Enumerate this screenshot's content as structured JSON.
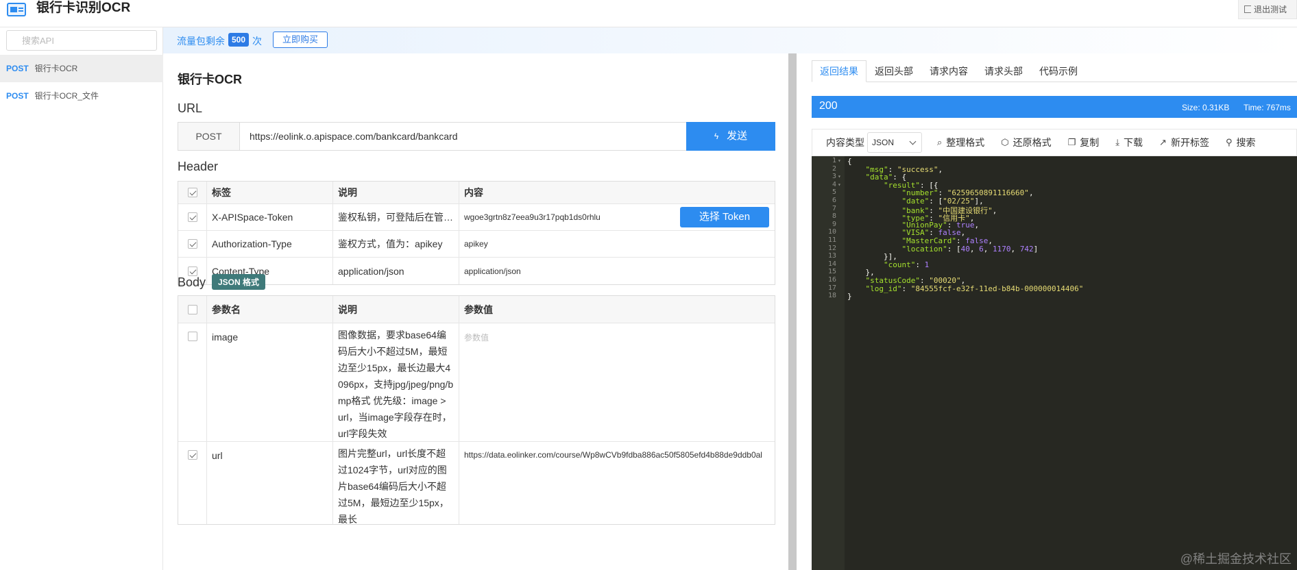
{
  "app": {
    "title": "银行卡识别OCR",
    "logout_label": "退出测试"
  },
  "sidebar": {
    "search_placeholder": "搜索API",
    "items": [
      {
        "method": "POST",
        "name": "银行卡OCR"
      },
      {
        "method": "POST",
        "name": "银行卡OCR_文件"
      }
    ]
  },
  "traffic": {
    "label": "流量包剩余",
    "count": "500",
    "unit": "次",
    "buy_label": "立即购买"
  },
  "main": {
    "title": "银行卡OCR",
    "url_label": "URL",
    "method": "POST",
    "url": "https://eolink.o.apispace.com/bankcard/bankcard",
    "send_label": "发送",
    "header_label": "Header",
    "header_table": {
      "columns": [
        "标签",
        "说明",
        "内容"
      ],
      "rows": [
        {
          "checked": true,
          "key": "X-APISpace-Token",
          "desc": "鉴权私钥，可登陆后在管理控制台获取",
          "value": "wgoe3grtn8z7eea9u3r17pqb1ds0rhlu"
        },
        {
          "checked": true,
          "key": "Authorization-Type",
          "desc": "鉴权方式，值为：apikey",
          "value": "apikey"
        },
        {
          "checked": true,
          "key": "Content-Type",
          "desc": "application/json",
          "value": "application/json"
        }
      ],
      "token_button": "选择 Token"
    },
    "body_label": "Body",
    "body_badge": "JSON 格式",
    "body_table": {
      "columns": [
        "参数名",
        "说明",
        "参数值"
      ],
      "rows": [
        {
          "checked": false,
          "key": "image",
          "desc": "图像数据，要求base64编码后大小不超过5M，最短边至少15px，最长边最大4096px，支持jpg/jpeg/png/bmp格式 优先级：image > url，当image字段存在时，url字段失效",
          "value": "",
          "placeholder": "参数值"
        },
        {
          "checked": true,
          "key": "url",
          "desc": "图片完整url，url长度不超过1024字节，url对应的图片base64编码后大小不超过5M，最短边至少15px，最长",
          "value": "https://data.eolinker.com/course/Wp8wCVb9fdba886ac50f5805efd4b88de9ddb0al",
          "placeholder": ""
        }
      ]
    }
  },
  "response": {
    "tabs": [
      "返回结果",
      "返回头部",
      "请求内容",
      "请求头部",
      "代码示例"
    ],
    "active_tab": 0,
    "status": "200",
    "size": "Size: 0.31KB",
    "time": "Time: 767ms",
    "content_type_label": "内容类型",
    "content_type": "JSON",
    "tools": [
      {
        "icon": "format-icon",
        "label": "整理格式"
      },
      {
        "icon": "restore-icon",
        "label": "还原格式"
      },
      {
        "icon": "copy-icon",
        "label": "复制"
      },
      {
        "icon": "download-icon",
        "label": "下载"
      },
      {
        "icon": "new-tab-icon",
        "label": "新开标签"
      },
      {
        "icon": "search-icon",
        "label": "搜索"
      }
    ],
    "code_lines": [
      "{",
      "    \"msg\": \"success\",",
      "    \"data\": {",
      "        \"result\": [{",
      "            \"number\": \"6259650891116660\",",
      "            \"date\": [\"02/25\"],",
      "            \"bank\": \"中国建设银行\",",
      "            \"type\": \"信用卡\",",
      "            \"UnionPay\": true,",
      "            \"VISA\": false,",
      "            \"MasterCard\": false,",
      "            \"location\": [40, 6, 1170, 742]",
      "        }],",
      "        \"count\": 1",
      "    },",
      "    \"statusCode\": \"00020\",",
      "    \"log_id\": \"84555fcf-e32f-11ed-b84b-000000014406\"",
      "}"
    ],
    "fold_lines": [
      1,
      3,
      4
    ]
  },
  "watermark": "@稀土掘金技术社区",
  "colors": {
    "primary": "#2d8cf0",
    "badge": "#3f7a7a",
    "editor_bg": "#272822"
  }
}
